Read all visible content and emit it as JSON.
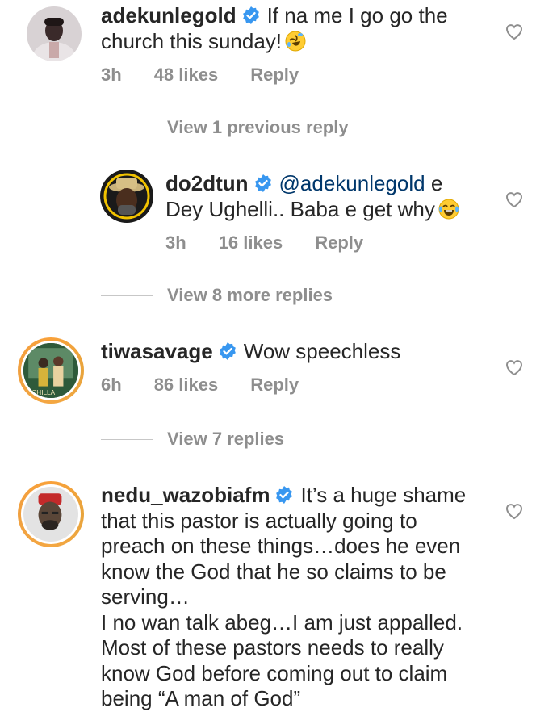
{
  "comments": [
    {
      "username": "adekunlegold",
      "text_line1": "If na me I go go the",
      "text_line2": "church this sunday!",
      "time": "3h",
      "likes": "48 likes",
      "reply": "Reply",
      "emoji": "rolling-laughing-emoji"
    },
    {
      "username": "do2dtun",
      "mention": "@adekunlegold",
      "text_line1_rest": "e",
      "text_line2": "Dey Ughelli.. Baba e get why",
      "time": "3h",
      "likes": "16 likes",
      "reply": "Reply",
      "emoji": "laughing-tears-emoji"
    },
    {
      "username": "tiwasavage",
      "text_line1": "Wow speechless",
      "time": "6h",
      "likes": "86 likes",
      "reply": "Reply",
      "avatar_caption": "CHILLA"
    },
    {
      "username": "nedu_wazobiafm",
      "text_line1": "It’s a huge shame",
      "lines": [
        "that this pastor is actually going to",
        "preach on these things…does he even",
        "know the God that he so claims to be",
        "serving…",
        "I no wan talk abeg…I am just appalled.",
        "Most of these pastors needs to really",
        "know God before coming out to claim",
        "being “A man of God”"
      ]
    }
  ],
  "view_previous": "View 1 previous reply",
  "view_more": "View 8 more replies",
  "view_replies": "View 7 replies",
  "colors": {
    "text": "#262626",
    "meta": "#8e8e8e",
    "mention": "#00376b",
    "verified": "#3897f0",
    "story_ring": "#f9a13a"
  }
}
